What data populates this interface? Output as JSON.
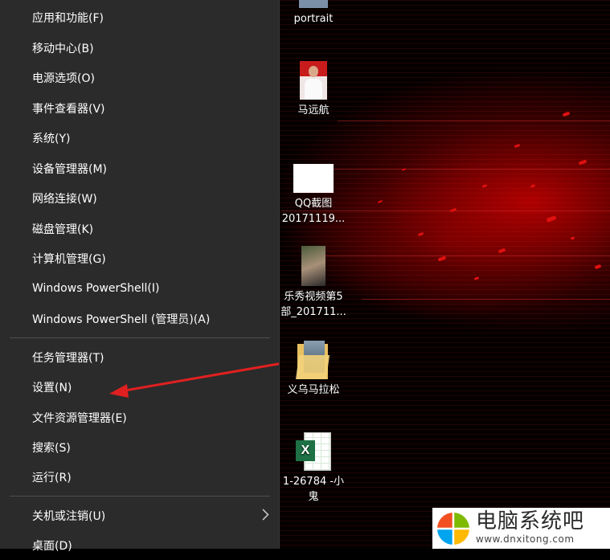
{
  "menu": {
    "items": [
      {
        "label": "应用和功能(F)"
      },
      {
        "label": "移动中心(B)"
      },
      {
        "label": "电源选项(O)"
      },
      {
        "label": "事件查看器(V)"
      },
      {
        "label": "系统(Y)"
      },
      {
        "label": "设备管理器(M)"
      },
      {
        "label": "网络连接(W)"
      },
      {
        "label": "磁盘管理(K)"
      },
      {
        "label": "计算机管理(G)"
      },
      {
        "label": "Windows PowerShell(I)"
      },
      {
        "label": "Windows PowerShell (管理员)(A)"
      },
      {
        "label": "任务管理器(T)"
      },
      {
        "label": "设置(N)"
      },
      {
        "label": "文件资源管理器(E)"
      },
      {
        "label": "搜索(S)"
      },
      {
        "label": "运行(R)"
      },
      {
        "label": "关机或注销(U)"
      },
      {
        "label": "桌面(D)"
      }
    ],
    "submenu_icon": "chevron-right-icon"
  },
  "desktop": {
    "icons": [
      {
        "label_line1": "portrait",
        "label_line2": "",
        "icon": "image-thumbnail-icon"
      },
      {
        "label_line1": "马远航",
        "label_line2": "",
        "icon": "photo-thumbnail-icon"
      },
      {
        "label_line1": "QQ截图",
        "label_line2": "20171119...",
        "icon": "screenshot-thumbnail-icon"
      },
      {
        "label_line1": "乐秀视频第5",
        "label_line2": "部_201711...",
        "icon": "video-thumbnail-icon"
      },
      {
        "label_line1": "义乌马拉松",
        "label_line2": "",
        "icon": "folder-icon"
      },
      {
        "label_line1": "1-26784 -小",
        "label_line2": "鬼",
        "icon": "excel-file-icon"
      }
    ]
  },
  "annotation": {
    "icon": "red-arrow-icon",
    "color": "#e02020"
  },
  "watermark": {
    "title": "电脑系统吧",
    "url": "www.dnxitong.com",
    "icon": "windows-logo-icon",
    "logo_colors": [
      "#f25022",
      "#7fba00",
      "#00a4ef",
      "#ffb900"
    ]
  }
}
